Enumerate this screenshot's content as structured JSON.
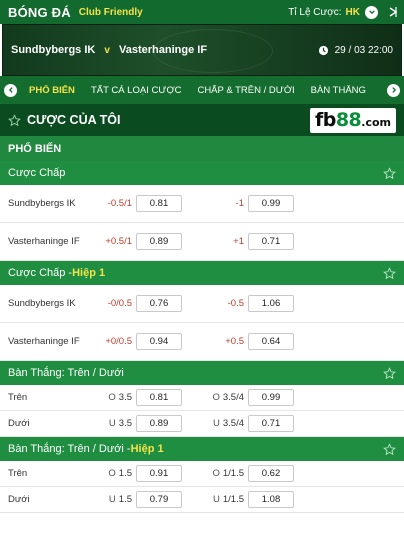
{
  "header": {
    "title": "BÓNG ĐÁ",
    "subtitle": "Club Friendly",
    "odds_label": "Tỉ Lệ Cược:",
    "odds_value": "HK"
  },
  "match": {
    "home": "Sundbybergs IK",
    "vs": "v",
    "away": "Vasterhaninge IF",
    "datetime": "29 / 03  22:00"
  },
  "tabs": [
    {
      "label": "PHỔ BIẾN",
      "active": true
    },
    {
      "label": "TẤT CẢ LOẠI CƯỢC",
      "active": false
    },
    {
      "label": "CHẤP & TRÊN / DƯỚI",
      "active": false
    },
    {
      "label": "BÀN THẮNG",
      "active": false
    }
  ],
  "mybets": {
    "label": "CƯỢC CỦA TÔI",
    "logo_fb": "fb",
    "logo_num": "88",
    "logo_dom": ".com"
  },
  "section": "PHỔ BIẾN",
  "markets": [
    {
      "title": "Cược Chấp",
      "suffix": "",
      "rows": [
        {
          "name": "Sundbybergs IK",
          "h1": "-0.5/1",
          "o1": "0.81",
          "h2": "-1",
          "o2": "0.99"
        },
        {
          "name": "Vasterhaninge IF",
          "h1": "+0.5/1",
          "o1": "0.89",
          "h2": "+1",
          "o2": "0.71"
        }
      ]
    },
    {
      "title": "Cược Chấp - ",
      "suffix": "Hiệp 1",
      "rows": [
        {
          "name": "Sundbybergs IK",
          "h1": "-0/0.5",
          "o1": "0.76",
          "h2": "-0.5",
          "o2": "1.06"
        },
        {
          "name": "Vasterhaninge IF",
          "h1": "+0/0.5",
          "o1": "0.94",
          "h2": "+0.5",
          "o2": "0.64"
        }
      ]
    },
    {
      "title": "Bàn Thắng: Trên / Dưới",
      "suffix": "",
      "rows": [
        {
          "name": "Trên",
          "ou1": "O",
          "h1": "3.5",
          "o1": "0.81",
          "ou2": "O",
          "h2": "3.5/4",
          "o2": "0.99"
        },
        {
          "name": "Dưới",
          "ou1": "U",
          "h1": "3.5",
          "o1": "0.89",
          "ou2": "U",
          "h2": "3.5/4",
          "o2": "0.71"
        }
      ]
    },
    {
      "title": "Bàn Thắng: Trên / Dưới - ",
      "suffix": "Hiệp 1",
      "rows": [
        {
          "name": "Trên",
          "ou1": "O",
          "h1": "1.5",
          "o1": "0.91",
          "ou2": "O",
          "h2": "1/1.5",
          "o2": "0.62"
        },
        {
          "name": "Dưới",
          "ou1": "U",
          "h1": "1.5",
          "o1": "0.79",
          "ou2": "U",
          "h2": "1/1.5",
          "o2": "1.08"
        }
      ]
    }
  ],
  "colors": {
    "header_green": "#136a2e",
    "accent_yellow": "#f4e34a",
    "market_green": "#1f8e41",
    "negative_red": "#c73a2a"
  }
}
